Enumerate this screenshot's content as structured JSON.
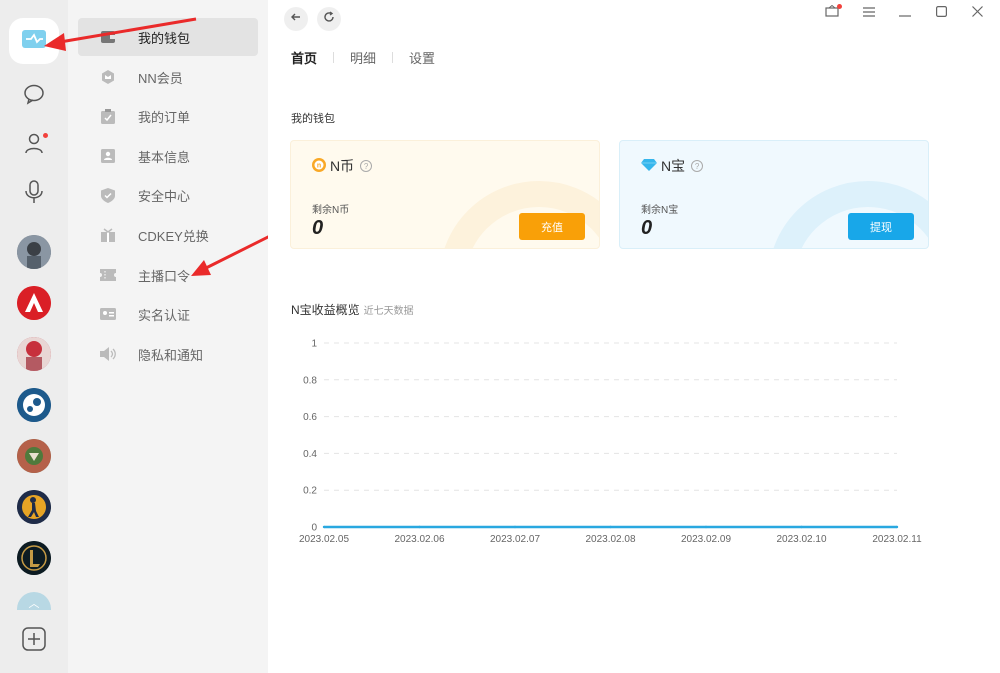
{
  "sidebar_rail": {
    "items": [
      "wallet-icon",
      "chat-icon",
      "user-icon",
      "microphone-icon"
    ],
    "games": [
      "pubg",
      "apex-legends",
      "game-3",
      "steam",
      "gta-v",
      "csgo",
      "league-of-legends"
    ],
    "add_label": "+"
  },
  "menu": {
    "items": [
      {
        "label": "我的钱包",
        "icon": "wallet-icon"
      },
      {
        "label": "NN会员",
        "icon": "crown-icon"
      },
      {
        "label": "我的订单",
        "icon": "order-icon"
      },
      {
        "label": "基本信息",
        "icon": "profile-icon"
      },
      {
        "label": "安全中心",
        "icon": "shield-icon"
      },
      {
        "label": "CDKEY兑换",
        "icon": "gift-icon"
      },
      {
        "label": "主播口令",
        "icon": "ticket-icon"
      },
      {
        "label": "实名认证",
        "icon": "id-card-icon"
      },
      {
        "label": "隐私和通知",
        "icon": "speaker-icon"
      }
    ]
  },
  "tabs": [
    {
      "label": "首页",
      "active": true
    },
    {
      "label": "明细",
      "active": false
    },
    {
      "label": "设置",
      "active": false
    }
  ],
  "wallet": {
    "section_title": "我的钱包",
    "coin_card": {
      "title": "N币",
      "sub": "剩余N币",
      "value": "0",
      "button": "充值"
    },
    "nbao_card": {
      "title": "N宝",
      "sub": "剩余N宝",
      "value": "0",
      "button": "提现"
    }
  },
  "chart_heading": {
    "title": "N宝收益概览",
    "subtitle": "近七天数据"
  },
  "colors": {
    "accent_orange": "#f9a008",
    "accent_blue": "#18a7e9",
    "line": "#29a8e0"
  },
  "chart_data": {
    "type": "line",
    "title": "N宝收益概览",
    "x": [
      "2023.02.05",
      "2023.02.06",
      "2023.02.07",
      "2023.02.08",
      "2023.02.09",
      "2023.02.10",
      "2023.02.11"
    ],
    "series": [
      {
        "values": [
          0,
          0,
          0,
          0,
          0,
          0,
          0
        ]
      }
    ],
    "yticks": [
      "0",
      "0.2",
      "0.4",
      "0.6",
      "0.8",
      "1"
    ],
    "ylim": [
      0,
      1
    ],
    "grid": true
  }
}
